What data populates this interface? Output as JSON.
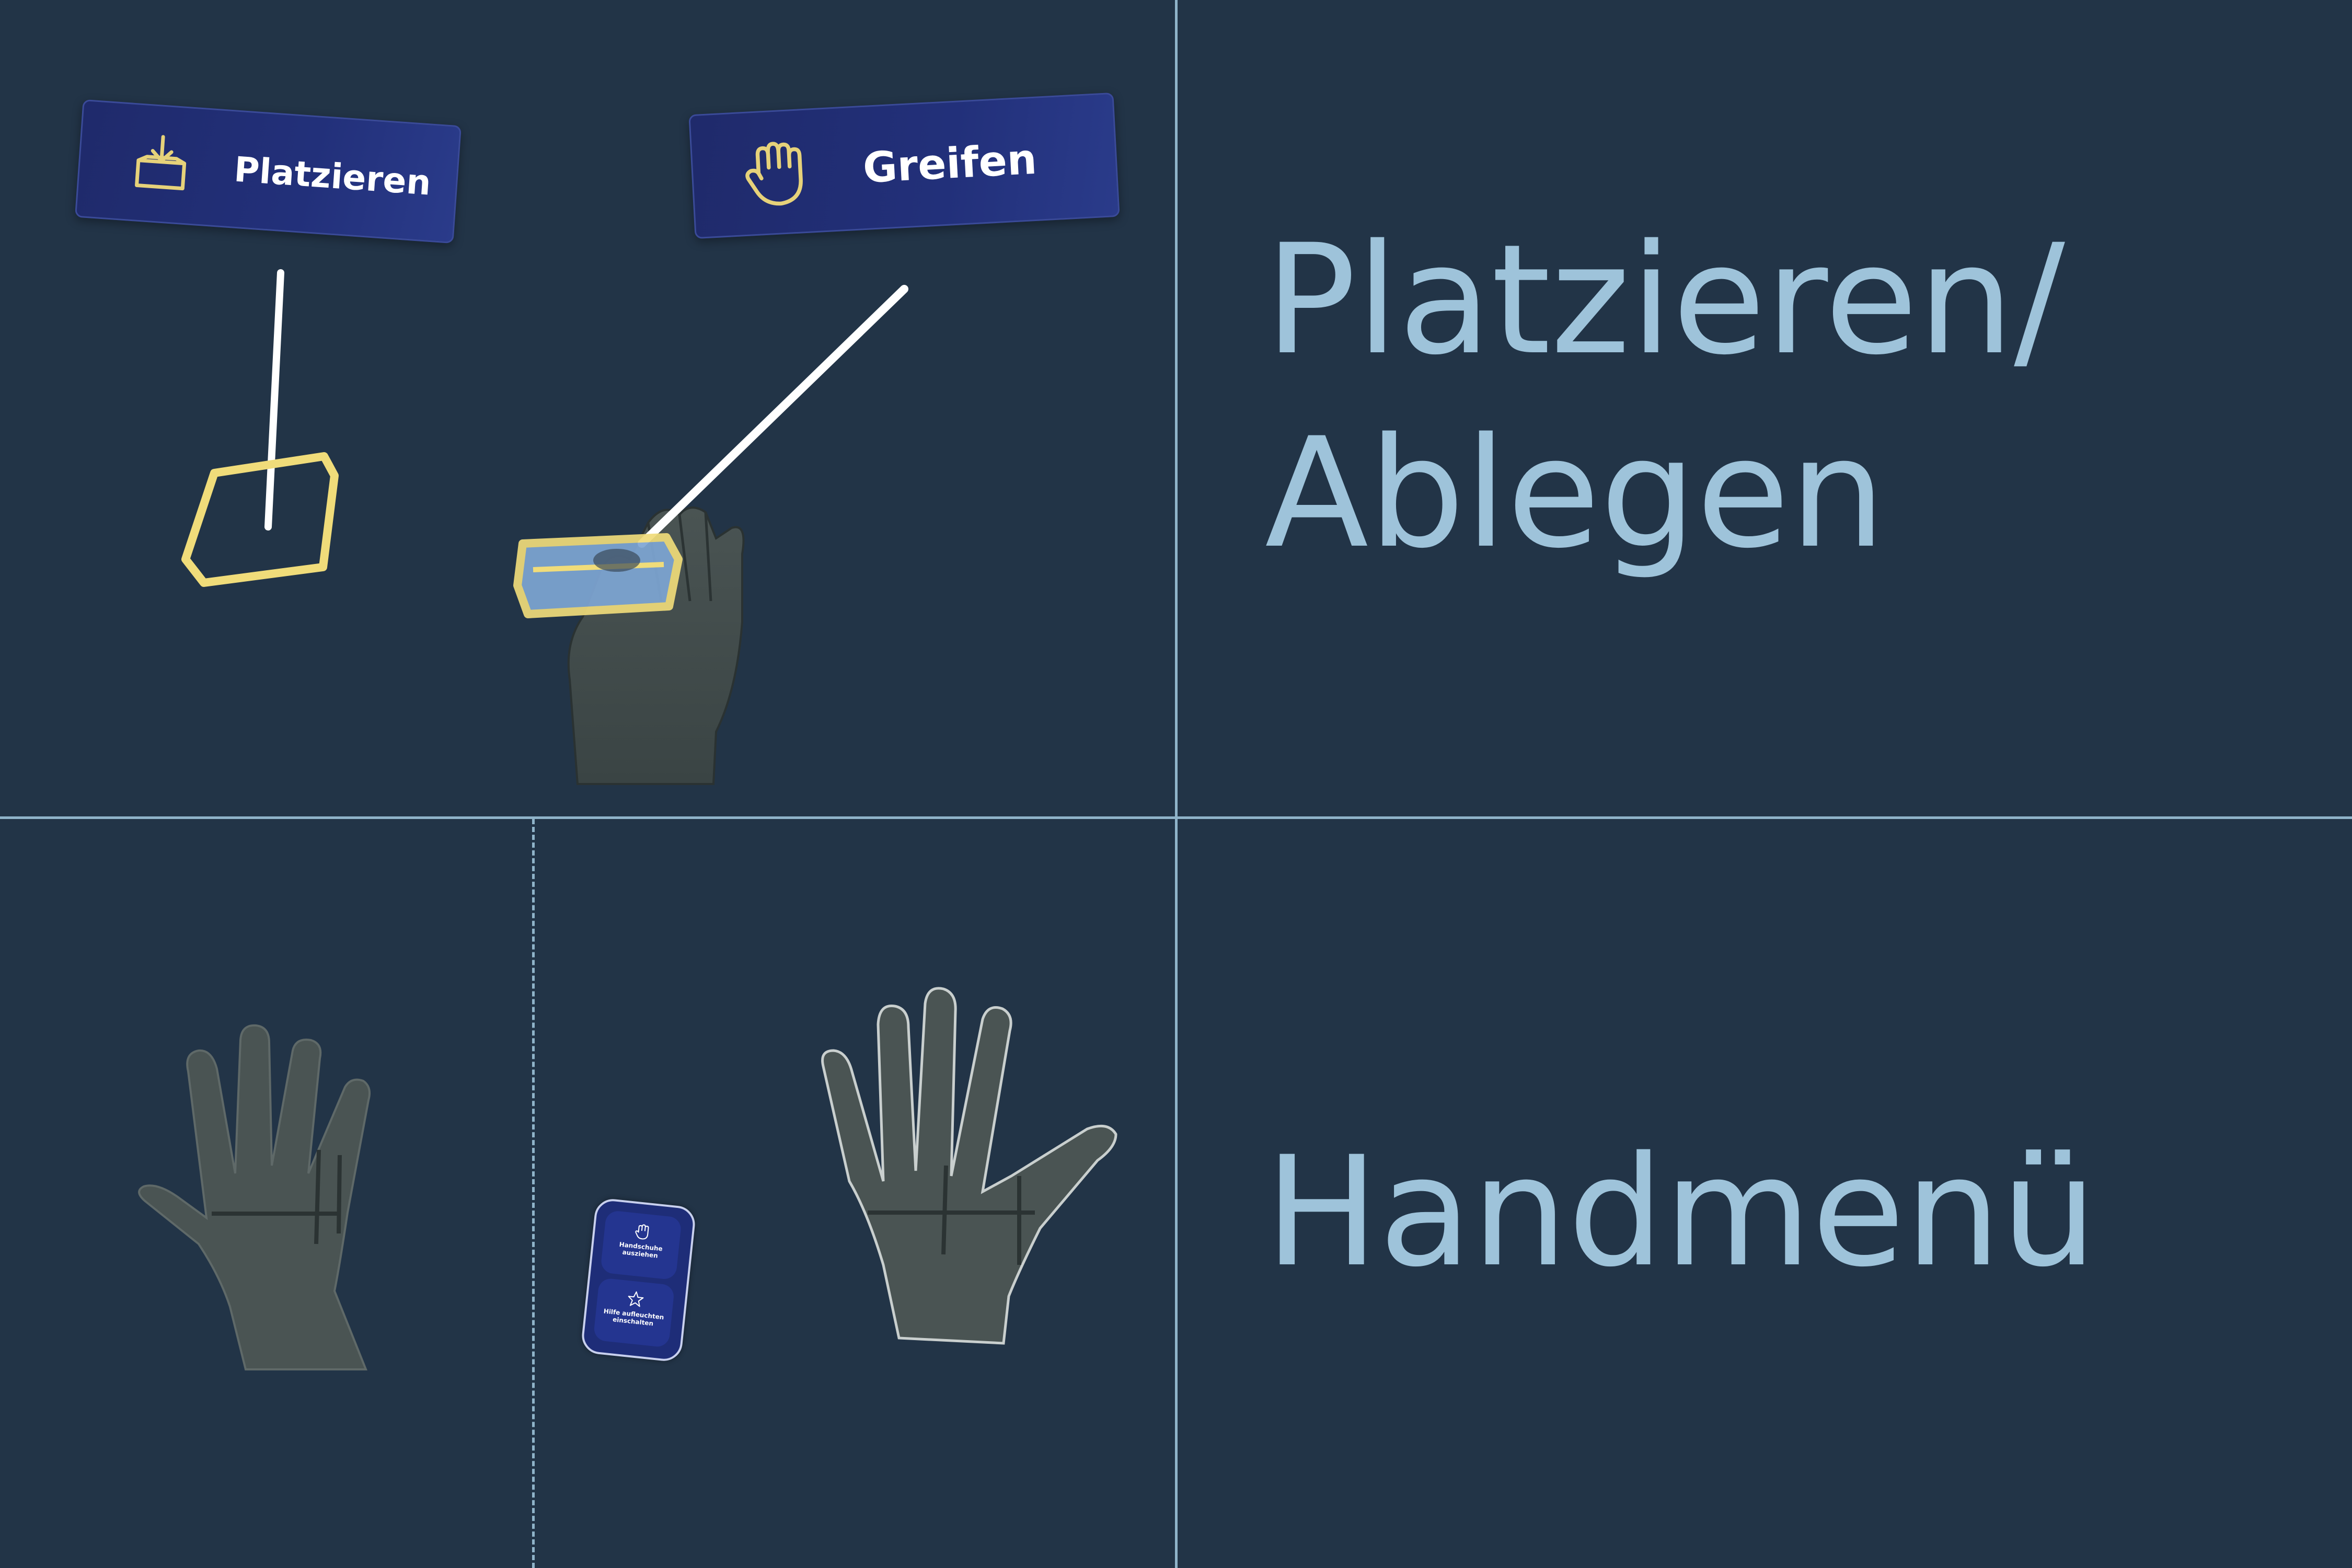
{
  "top_left_panel": {
    "place_button": {
      "label": "Platzieren",
      "icon": "box-drop-icon"
    },
    "grab_button": {
      "label": "Greifen",
      "icon": "hand-grab-icon"
    }
  },
  "top_right_panel": {
    "caption_line1": "Platzieren/",
    "caption_line2": "Ablegen"
  },
  "bottom_middle_panel": {
    "hand_menu": {
      "item1": {
        "label_line1": "Handschuhe",
        "label_line2": "ausziehen",
        "icon": "glove-icon"
      },
      "item2": {
        "label_line1": "Hilfe aufleuchten",
        "label_line2": "einschalten",
        "icon": "star-icon"
      }
    }
  },
  "bottom_right_panel": {
    "caption": "Handmenü"
  },
  "colors": {
    "background": "#223447",
    "divider": "#8fb3c9",
    "caption": "#9ec3da",
    "button_bg": "#1f2a6b",
    "highlight": "#f0dc7a"
  }
}
